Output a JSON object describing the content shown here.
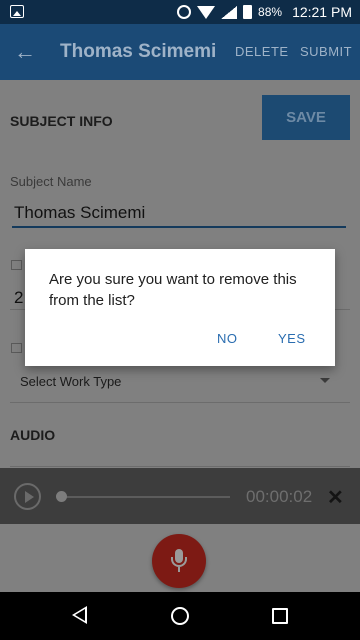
{
  "status_bar": {
    "battery": "88%",
    "time": "12:21 PM"
  },
  "app_bar": {
    "title": "Thomas Scimemi",
    "delete_label": "DELETE",
    "submit_label": "SUBMIT"
  },
  "subject_info": {
    "heading": "SUBJECT INFO",
    "save_label": "SAVE",
    "subject_name_label": "Subject Name",
    "subject_name_value": "Thomas Scimemi",
    "partial_field_value": "2"
  },
  "work_type": {
    "selected": "Select Work Type"
  },
  "audio": {
    "heading": "AUDIO",
    "time": "00:00:02"
  },
  "dialog": {
    "message": "Are you sure you want to remove this from the list?",
    "no_label": "NO",
    "yes_label": "YES"
  },
  "colors": {
    "app_bar": "#1b4a76",
    "status_bar": "#0e2c48",
    "accent_button": "#2a6db0",
    "mic_fab": "#c62828"
  },
  "icons": [
    "image-icon",
    "alarm-icon",
    "wifi-icon",
    "signal-icon",
    "battery-icon",
    "back-arrow-icon",
    "play-icon",
    "close-icon",
    "mic-icon",
    "nav-back-icon",
    "nav-home-icon",
    "nav-recents-icon"
  ]
}
